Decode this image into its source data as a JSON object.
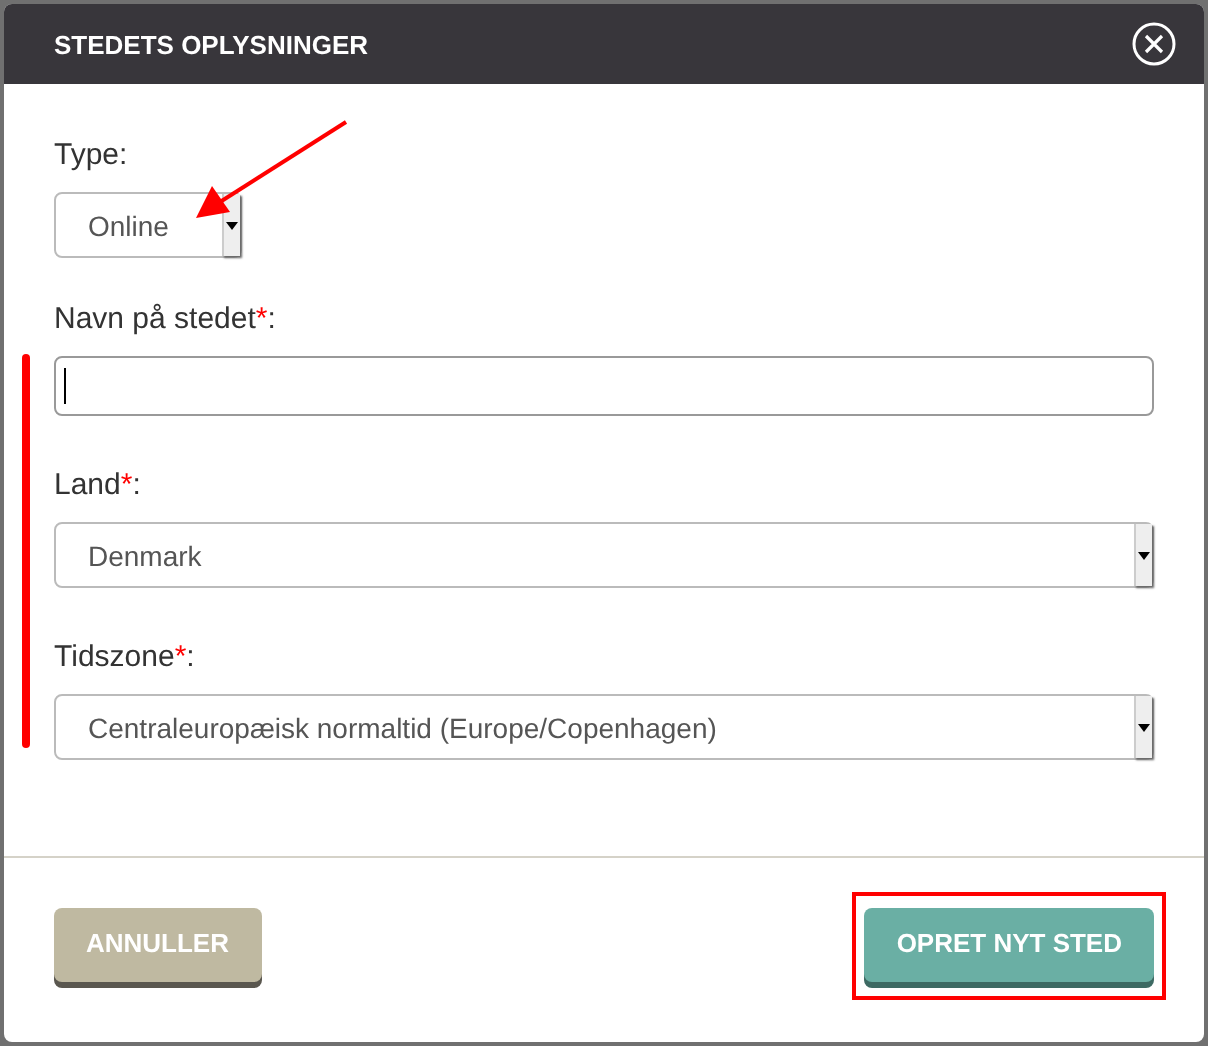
{
  "dialog": {
    "title": "STEDETS OPLYSNINGER"
  },
  "fields": [
    {
      "kind": "select",
      "label": "Type:",
      "value": "Online",
      "wide": false
    },
    {
      "kind": "text",
      "label": "Navn på stedet",
      "required_mark": "*",
      "label_end": ":",
      "focused": true,
      "wide": true
    },
    {
      "kind": "select",
      "label": "Land",
      "required_mark": "*",
      "label_end": ":",
      "value": "Denmark",
      "wide": true
    },
    {
      "kind": "select",
      "label": "Tidszone",
      "required_mark": "*",
      "label_end": ":",
      "value": "Centraleuropæisk normaltid (Europe/Copenhagen)",
      "wide": true
    }
  ],
  "buttons": [
    {
      "label": "ANNULLER",
      "kind": "secondary"
    },
    {
      "label": "OPRET NYT STED",
      "kind": "primary"
    }
  ]
}
